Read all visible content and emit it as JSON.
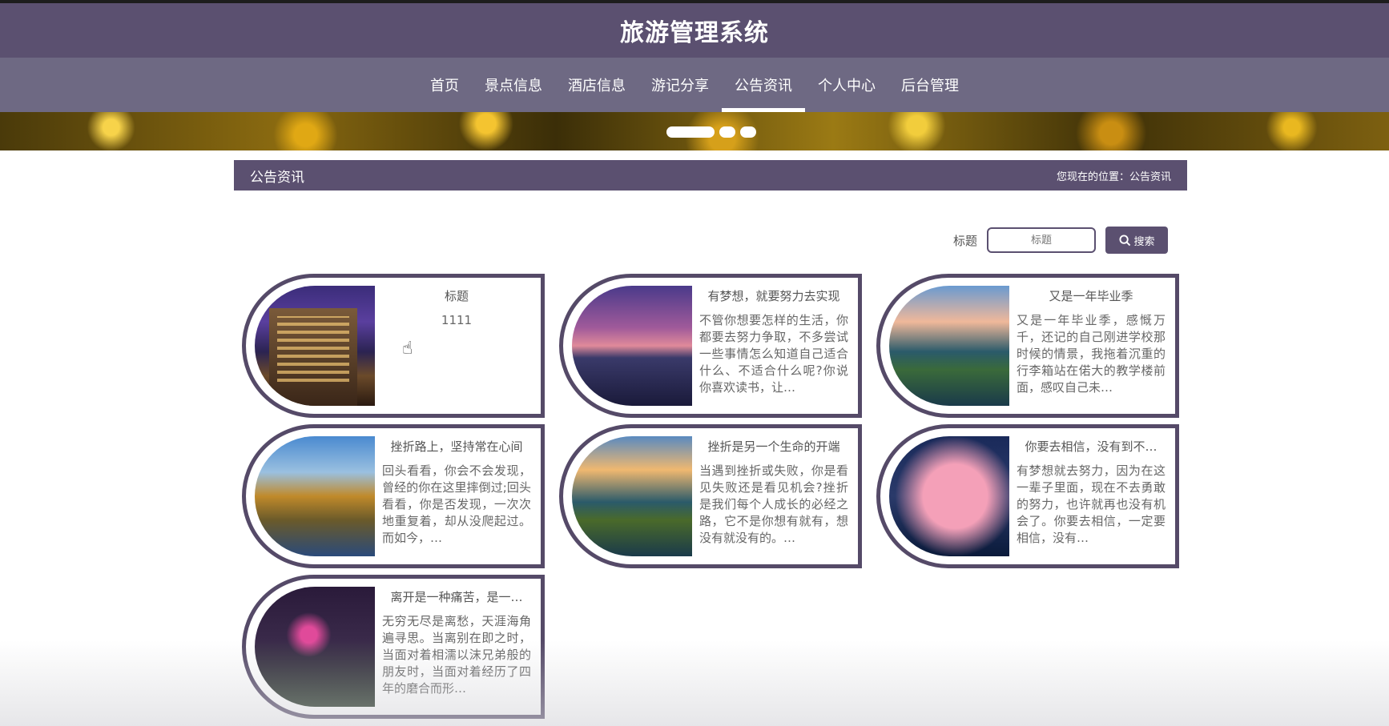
{
  "header": {
    "title": "旅游管理系统"
  },
  "nav": {
    "items": [
      {
        "label": "首页"
      },
      {
        "label": "景点信息"
      },
      {
        "label": "酒店信息"
      },
      {
        "label": "游记分享"
      },
      {
        "label": "公告资讯"
      },
      {
        "label": "个人中心"
      },
      {
        "label": "后台管理"
      }
    ],
    "active_index": 4
  },
  "carousel": {
    "slide_count": 3,
    "active_slide": 1
  },
  "section": {
    "title": "公告资讯",
    "breadcrumb": "您现在的位置：公告资讯"
  },
  "search": {
    "label": "标题",
    "placeholder": "标题",
    "button_label": "搜索"
  },
  "cards": [
    {
      "title": "标题",
      "content": "1111"
    },
    {
      "title": "有梦想，就要努力去实现",
      "content": "不管你想要怎样的生活，你都要去努力争取，不多尝试一些事情怎么知道自己适合什么、不适合什么呢?你说你喜欢读书，让…"
    },
    {
      "title": "又是一年毕业季",
      "content": "又是一年毕业季，感慨万千，还记的自己刚进学校那时候的情景，我拖着沉重的行李箱站在偌大的教学楼前面，感叹自己未…"
    },
    {
      "title": "挫折路上，坚持常在心间",
      "content": "回头看看，你会不会发现，曾经的你在这里摔倒过;回头看看，你是否发现，一次次地重复着，却从没爬起过。而如今，…"
    },
    {
      "title": "挫折是另一个生命的开端",
      "content": "当遇到挫折或失败，你是看见失败还是看见机会?挫折是我们每个人成长的必经之路，它不是你想有就有，想没有就没有的。…"
    },
    {
      "title": "你要去相信，没有到不…",
      "content": "有梦想就去努力，因为在这一辈子里面，现在不去勇敢的努力，也许就再也没有机会了。你要去相信，一定要相信，没有…"
    },
    {
      "title": "离开是一种痛苦，是一…",
      "content": "无穷无尽是离愁，天涯海角遍寻思。当离别在即之时，当面对着相濡以沫兄弟般的朋友时，当面对着经历了四年的磨合而形…"
    }
  ]
}
